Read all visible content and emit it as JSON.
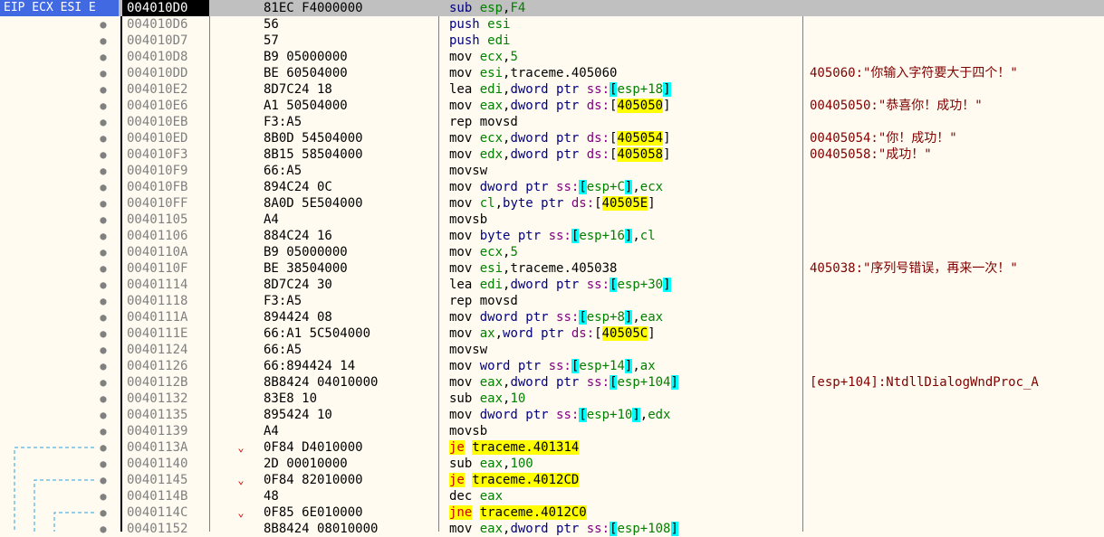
{
  "register_label": "EIP ECX ESI E",
  "rows": [
    {
      "addr": "004010D0",
      "bytes": "81EC F4000000",
      "instr": [
        [
          "mn",
          "sub "
        ],
        [
          "reg",
          "esp"
        ],
        [
          "t",
          ","
        ],
        [
          "num",
          "F4"
        ]
      ],
      "comment": ""
    },
    {
      "addr": "004010D6",
      "bytes": "56",
      "instr": [
        [
          "mn",
          "push "
        ],
        [
          "reg",
          "esi"
        ]
      ],
      "comment": ""
    },
    {
      "addr": "004010D7",
      "bytes": "57",
      "instr": [
        [
          "mn",
          "push "
        ],
        [
          "reg",
          "edi"
        ]
      ],
      "comment": ""
    },
    {
      "addr": "004010D8",
      "bytes": "B9 05000000",
      "instr": [
        [
          "t",
          "mov "
        ],
        [
          "reg",
          "ecx"
        ],
        [
          "t",
          ","
        ],
        [
          "num",
          "5"
        ]
      ],
      "comment": ""
    },
    {
      "addr": "004010DD",
      "bytes": "BE 60504000",
      "instr": [
        [
          "t",
          "mov "
        ],
        [
          "reg",
          "esi"
        ],
        [
          "t",
          ",traceme.405060"
        ]
      ],
      "comment": "405060:\"你输入字符要大于四个！\""
    },
    {
      "addr": "004010E2",
      "bytes": "8D7C24 18",
      "instr": [
        [
          "t",
          "lea "
        ],
        [
          "reg",
          "edi"
        ],
        [
          "t",
          ","
        ],
        [
          "sz",
          "dword ptr "
        ],
        [
          "seg",
          "ss:"
        ],
        [
          "brk",
          "["
        ],
        [
          "reg",
          "esp+18"
        ],
        [
          "brk",
          "]"
        ]
      ],
      "comment": ""
    },
    {
      "addr": "004010E6",
      "bytes": "A1 50504000",
      "instr": [
        [
          "t",
          "mov "
        ],
        [
          "reg",
          "eax"
        ],
        [
          "t",
          ","
        ],
        [
          "sz",
          "dword ptr "
        ],
        [
          "seg",
          "ds:"
        ],
        [
          "t",
          "["
        ],
        [
          "hl",
          "405050"
        ],
        [
          "t",
          "]"
        ]
      ],
      "comment": "00405050:\"恭喜你！成功！\""
    },
    {
      "addr": "004010EB",
      "bytes": "F3:A5",
      "instr": [
        [
          "t",
          "rep movsd"
        ]
      ],
      "comment": ""
    },
    {
      "addr": "004010ED",
      "bytes": "8B0D 54504000",
      "instr": [
        [
          "t",
          "mov "
        ],
        [
          "reg",
          "ecx"
        ],
        [
          "t",
          ","
        ],
        [
          "sz",
          "dword ptr "
        ],
        [
          "seg",
          "ds:"
        ],
        [
          "t",
          "["
        ],
        [
          "hl",
          "405054"
        ],
        [
          "t",
          "]"
        ]
      ],
      "comment": "00405054:\"你！成功！\""
    },
    {
      "addr": "004010F3",
      "bytes": "8B15 58504000",
      "instr": [
        [
          "t",
          "mov "
        ],
        [
          "reg",
          "edx"
        ],
        [
          "t",
          ","
        ],
        [
          "sz",
          "dword ptr "
        ],
        [
          "seg",
          "ds:"
        ],
        [
          "t",
          "["
        ],
        [
          "hl",
          "405058"
        ],
        [
          "t",
          "]"
        ]
      ],
      "comment": "00405058:\"成功！\""
    },
    {
      "addr": "004010F9",
      "bytes": "66:A5",
      "instr": [
        [
          "t",
          "movsw"
        ]
      ],
      "comment": ""
    },
    {
      "addr": "004010FB",
      "bytes": "894C24 0C",
      "instr": [
        [
          "t",
          "mov "
        ],
        [
          "sz",
          "dword ptr "
        ],
        [
          "seg",
          "ss:"
        ],
        [
          "brk",
          "["
        ],
        [
          "reg",
          "esp+C"
        ],
        [
          "brk",
          "]"
        ],
        [
          "t",
          ","
        ],
        [
          "reg",
          "ecx"
        ]
      ],
      "comment": ""
    },
    {
      "addr": "004010FF",
      "bytes": "8A0D 5E504000",
      "instr": [
        [
          "t",
          "mov "
        ],
        [
          "reg",
          "cl"
        ],
        [
          "t",
          ","
        ],
        [
          "sz",
          "byte ptr "
        ],
        [
          "seg",
          "ds:"
        ],
        [
          "t",
          "["
        ],
        [
          "hl",
          "40505E"
        ],
        [
          "t",
          "]"
        ]
      ],
      "comment": ""
    },
    {
      "addr": "00401105",
      "bytes": "A4",
      "instr": [
        [
          "t",
          "movsb"
        ]
      ],
      "comment": ""
    },
    {
      "addr": "00401106",
      "bytes": "884C24 16",
      "instr": [
        [
          "t",
          "mov "
        ],
        [
          "sz",
          "byte ptr "
        ],
        [
          "seg",
          "ss:"
        ],
        [
          "brk",
          "["
        ],
        [
          "reg",
          "esp+16"
        ],
        [
          "brk",
          "]"
        ],
        [
          "t",
          ","
        ],
        [
          "reg",
          "cl"
        ]
      ],
      "comment": ""
    },
    {
      "addr": "0040110A",
      "bytes": "B9 05000000",
      "instr": [
        [
          "t",
          "mov "
        ],
        [
          "reg",
          "ecx"
        ],
        [
          "t",
          ","
        ],
        [
          "num",
          "5"
        ]
      ],
      "comment": ""
    },
    {
      "addr": "0040110F",
      "bytes": "BE 38504000",
      "instr": [
        [
          "t",
          "mov "
        ],
        [
          "reg",
          "esi"
        ],
        [
          "t",
          ",traceme.405038"
        ]
      ],
      "comment": "405038:\"序列号错误，再来一次！\""
    },
    {
      "addr": "00401114",
      "bytes": "8D7C24 30",
      "instr": [
        [
          "t",
          "lea "
        ],
        [
          "reg",
          "edi"
        ],
        [
          "t",
          ","
        ],
        [
          "sz",
          "dword ptr "
        ],
        [
          "seg",
          "ss:"
        ],
        [
          "brk",
          "["
        ],
        [
          "reg",
          "esp+30"
        ],
        [
          "brk",
          "]"
        ]
      ],
      "comment": ""
    },
    {
      "addr": "00401118",
      "bytes": "F3:A5",
      "instr": [
        [
          "t",
          "rep movsd"
        ]
      ],
      "comment": ""
    },
    {
      "addr": "0040111A",
      "bytes": "894424 08",
      "instr": [
        [
          "t",
          "mov "
        ],
        [
          "sz",
          "dword ptr "
        ],
        [
          "seg",
          "ss:"
        ],
        [
          "brk",
          "["
        ],
        [
          "reg",
          "esp+8"
        ],
        [
          "brk",
          "]"
        ],
        [
          "t",
          ","
        ],
        [
          "reg",
          "eax"
        ]
      ],
      "comment": ""
    },
    {
      "addr": "0040111E",
      "bytes": "66:A1 5C504000",
      "instr": [
        [
          "t",
          "mov "
        ],
        [
          "reg",
          "ax"
        ],
        [
          "t",
          ","
        ],
        [
          "sz",
          "word ptr "
        ],
        [
          "seg",
          "ds:"
        ],
        [
          "t",
          "["
        ],
        [
          "hl",
          "40505C"
        ],
        [
          "t",
          "]"
        ]
      ],
      "comment": ""
    },
    {
      "addr": "00401124",
      "bytes": "66:A5",
      "instr": [
        [
          "t",
          "movsw"
        ]
      ],
      "comment": ""
    },
    {
      "addr": "00401126",
      "bytes": "66:894424 14",
      "instr": [
        [
          "t",
          "mov "
        ],
        [
          "sz",
          "word ptr "
        ],
        [
          "seg",
          "ss:"
        ],
        [
          "brk",
          "["
        ],
        [
          "reg",
          "esp+14"
        ],
        [
          "brk",
          "]"
        ],
        [
          "t",
          ","
        ],
        [
          "reg",
          "ax"
        ]
      ],
      "comment": ""
    },
    {
      "addr": "0040112B",
      "bytes": "8B8424 04010000",
      "instr": [
        [
          "t",
          "mov "
        ],
        [
          "reg",
          "eax"
        ],
        [
          "t",
          ","
        ],
        [
          "sz",
          "dword ptr "
        ],
        [
          "seg",
          "ss:"
        ],
        [
          "brk",
          "["
        ],
        [
          "reg",
          "esp+104"
        ],
        [
          "brk",
          "]"
        ]
      ],
      "comment": "[esp+104]:NtdllDialogWndProc_A"
    },
    {
      "addr": "00401132",
      "bytes": "83E8 10",
      "instr": [
        [
          "t",
          "sub "
        ],
        [
          "reg",
          "eax"
        ],
        [
          "t",
          ","
        ],
        [
          "num",
          "10"
        ]
      ],
      "comment": ""
    },
    {
      "addr": "00401135",
      "bytes": "895424 10",
      "instr": [
        [
          "t",
          "mov "
        ],
        [
          "sz",
          "dword ptr "
        ],
        [
          "seg",
          "ss:"
        ],
        [
          "brk",
          "["
        ],
        [
          "reg",
          "esp+10"
        ],
        [
          "brk",
          "]"
        ],
        [
          "t",
          ","
        ],
        [
          "reg",
          "edx"
        ]
      ],
      "comment": ""
    },
    {
      "addr": "00401139",
      "bytes": "A4",
      "instr": [
        [
          "t",
          "movsb"
        ]
      ],
      "comment": ""
    },
    {
      "addr": "0040113A",
      "bytes": "0F84 D4010000",
      "instr": [
        [
          "jmp",
          "je"
        ],
        [
          "t",
          " "
        ],
        [
          "jmpt",
          "traceme.401314"
        ]
      ],
      "comment": "",
      "arrow": true
    },
    {
      "addr": "00401140",
      "bytes": "2D 00010000",
      "instr": [
        [
          "t",
          "sub "
        ],
        [
          "reg",
          "eax"
        ],
        [
          "t",
          ","
        ],
        [
          "num",
          "100"
        ]
      ],
      "comment": ""
    },
    {
      "addr": "00401145",
      "bytes": "0F84 82010000",
      "instr": [
        [
          "jmp",
          "je"
        ],
        [
          "t",
          " "
        ],
        [
          "jmpt",
          "traceme.4012CD"
        ]
      ],
      "comment": "",
      "arrow": true
    },
    {
      "addr": "0040114B",
      "bytes": "48",
      "instr": [
        [
          "t",
          "dec "
        ],
        [
          "reg",
          "eax"
        ]
      ],
      "comment": ""
    },
    {
      "addr": "0040114C",
      "bytes": "0F85 6E010000",
      "instr": [
        [
          "jmp",
          "jne"
        ],
        [
          "t",
          " "
        ],
        [
          "jmpt",
          "traceme.4012C0"
        ]
      ],
      "comment": "",
      "arrow": true
    },
    {
      "addr": "00401152",
      "bytes": "8B8424 08010000",
      "instr": [
        [
          "t",
          "mov "
        ],
        [
          "reg",
          "eax"
        ],
        [
          "t",
          ","
        ],
        [
          "sz",
          "dword ptr "
        ],
        [
          "seg",
          "ss:"
        ],
        [
          "brk",
          "["
        ],
        [
          "reg",
          "esp+108"
        ],
        [
          "brk",
          "]"
        ]
      ],
      "comment": ""
    }
  ]
}
